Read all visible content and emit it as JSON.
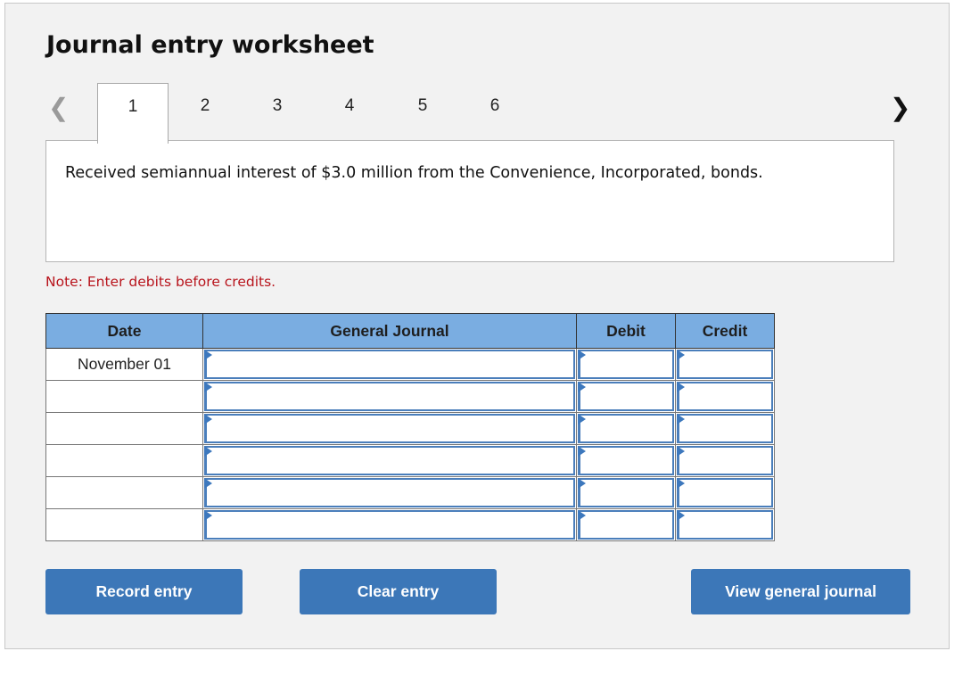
{
  "title": "Journal entry worksheet",
  "nav": {
    "prev_icon": "chevron-left-icon",
    "next_icon": "chevron-right-icon",
    "tabs": [
      {
        "label": "1",
        "active": true
      },
      {
        "label": "2",
        "active": false
      },
      {
        "label": "3",
        "active": false
      },
      {
        "label": "4",
        "active": false
      },
      {
        "label": "5",
        "active": false
      },
      {
        "label": "6",
        "active": false
      }
    ]
  },
  "description": "Received semiannual interest of $3.0 million from the Convenience, Incorporated, bonds.",
  "note": "Note: Enter debits before credits.",
  "table": {
    "headers": {
      "date": "Date",
      "general_journal": "General Journal",
      "debit": "Debit",
      "credit": "Credit"
    },
    "rows": [
      {
        "date": "November 01",
        "account": "",
        "debit": "",
        "credit": ""
      },
      {
        "date": "",
        "account": "",
        "debit": "",
        "credit": ""
      },
      {
        "date": "",
        "account": "",
        "debit": "",
        "credit": ""
      },
      {
        "date": "",
        "account": "",
        "debit": "",
        "credit": ""
      },
      {
        "date": "",
        "account": "",
        "debit": "",
        "credit": ""
      },
      {
        "date": "",
        "account": "",
        "debit": "",
        "credit": ""
      }
    ]
  },
  "buttons": {
    "record": "Record entry",
    "clear": "Clear entry",
    "view": "View general journal"
  },
  "colors": {
    "header_bg": "#7aade1",
    "button_bg": "#3c77b8",
    "note_text": "#b8141c",
    "input_border": "#4a7ebb"
  }
}
